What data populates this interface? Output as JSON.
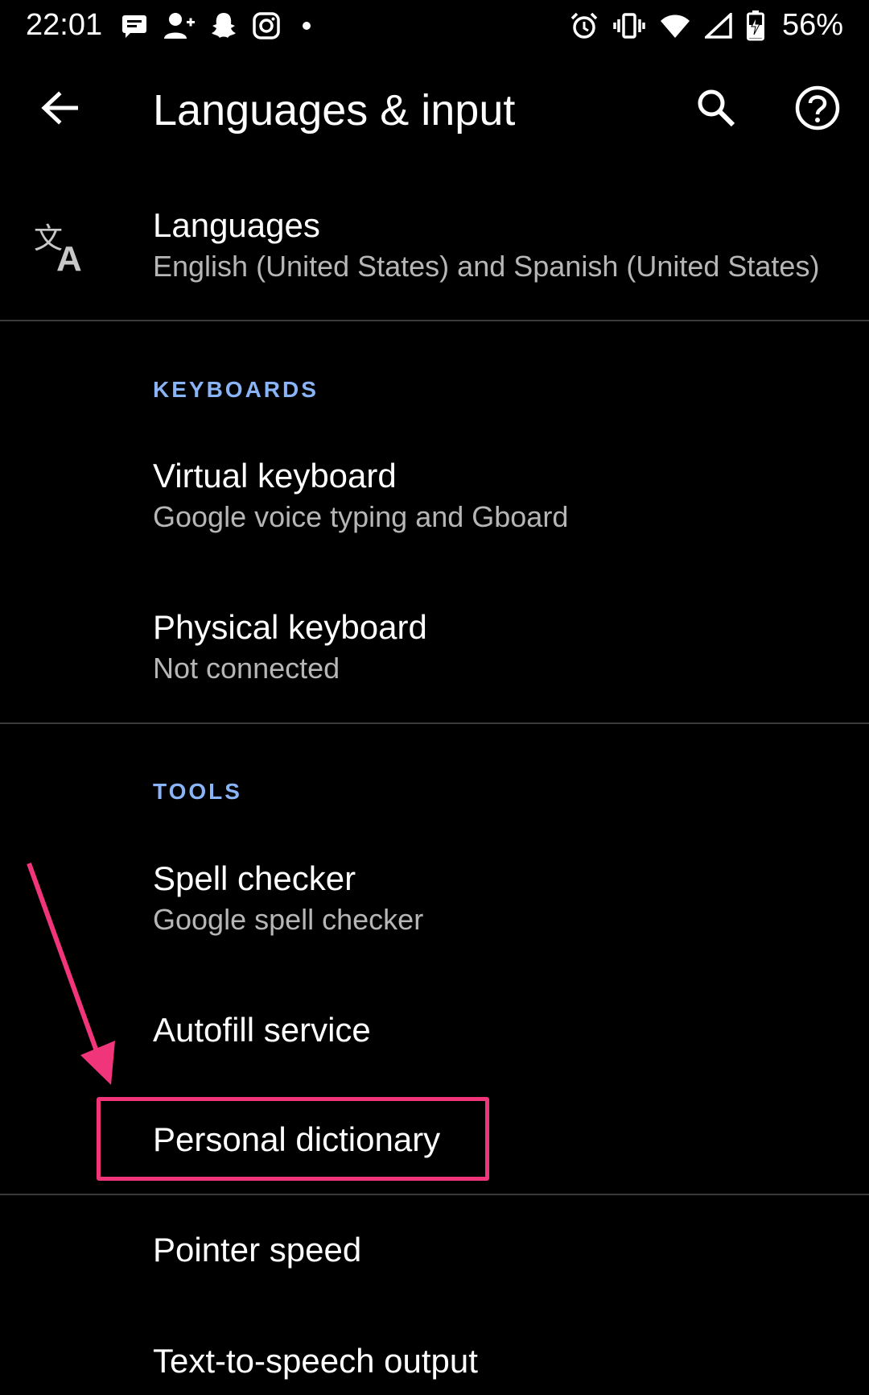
{
  "status_bar": {
    "time": "22:01",
    "left_icons": [
      "message-icon",
      "add-contact-icon",
      "snapchat-icon",
      "instagram-icon",
      "dot-icon"
    ],
    "right_icons": [
      "alarm-icon",
      "vibrate-icon",
      "wifi-icon",
      "signal-icon",
      "battery-charging-icon"
    ],
    "battery": "56%"
  },
  "app_bar": {
    "title": "Languages & input",
    "back_icon": "arrow-back-icon",
    "search_icon": "search-icon",
    "help_icon": "help-icon"
  },
  "items": {
    "languages": {
      "title": "Languages",
      "subtitle": "English (United States) and Spanish (United States)",
      "icon": "translate-icon"
    },
    "keyboards_header": "KEYBOARDS",
    "virtual_keyboard": {
      "title": "Virtual keyboard",
      "subtitle": "Google voice typing and Gboard"
    },
    "physical_keyboard": {
      "title": "Physical keyboard",
      "subtitle": "Not connected"
    },
    "tools_header": "TOOLS",
    "spell_checker": {
      "title": "Spell checker",
      "subtitle": "Google spell checker"
    },
    "autofill": {
      "title": "Autofill service"
    },
    "personal_dictionary": {
      "title": "Personal dictionary"
    },
    "pointer_speed": {
      "title": "Pointer speed"
    },
    "tts": {
      "title": "Text-to-speech output"
    }
  },
  "colors": {
    "background": "#000000",
    "accent_header": "#8ab4f8",
    "subtitle": "#b6b6b6",
    "annotation": "#f0357a",
    "divider": "#3a3a3a"
  }
}
